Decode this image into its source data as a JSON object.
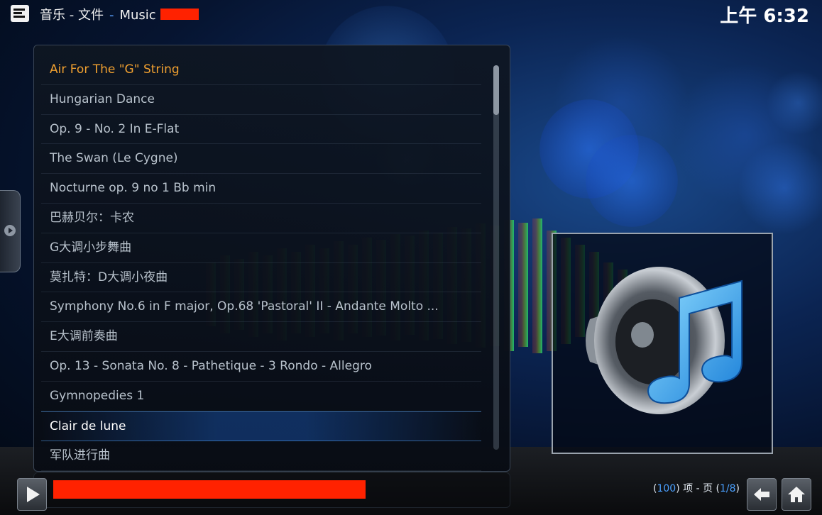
{
  "header": {
    "breadcrumb_root": "音乐 - 文件",
    "breadcrumb_sep": "-",
    "breadcrumb_current": "Music",
    "clock": "上午 6:32"
  },
  "list": {
    "items": [
      {
        "label": "Air For The \"G\" String",
        "state": "playing"
      },
      {
        "label": "Hungarian Dance",
        "state": "normal"
      },
      {
        "label": "Op. 9 - No. 2 In E-Flat",
        "state": "normal"
      },
      {
        "label": "The Swan (Le Cygne)",
        "state": "normal"
      },
      {
        "label": "Nocturne op. 9 no 1 Bb min",
        "state": "normal"
      },
      {
        "label": "巴赫贝尔：卡农",
        "state": "normal"
      },
      {
        "label": "G大调小步舞曲",
        "state": "normal"
      },
      {
        "label": "莫扎特：D大调小夜曲",
        "state": "normal"
      },
      {
        "label": "Symphony No.6 in F major, Op.68 'Pastoral' II - Andante Molto ...",
        "state": "normal"
      },
      {
        "label": "E大调前奏曲",
        "state": "normal"
      },
      {
        "label": "Op. 13 - Sonata No. 8 - Pathetique - 3 Rondo - Allegro",
        "state": "normal"
      },
      {
        "label": "Gymnopedies 1",
        "state": "normal"
      },
      {
        "label": "Clair de lune",
        "state": "focused"
      },
      {
        "label": "军队进行曲",
        "state": "normal"
      }
    ]
  },
  "footer": {
    "count_open": "(",
    "item_count": "100",
    "count_mid": ") 项 - 页 (",
    "page": "1/8",
    "count_close": ")"
  },
  "icons": {
    "logo": "kodi-logo-icon",
    "side_tab": "chevron-right-icon",
    "thumbnail": "speaker-music-note-icon",
    "play": "play-icon",
    "back": "back-arrow-icon",
    "home": "home-icon"
  },
  "colors": {
    "playing_text": "#f0a030",
    "accent": "#4aa0ff",
    "redaction": "#ff2200"
  }
}
